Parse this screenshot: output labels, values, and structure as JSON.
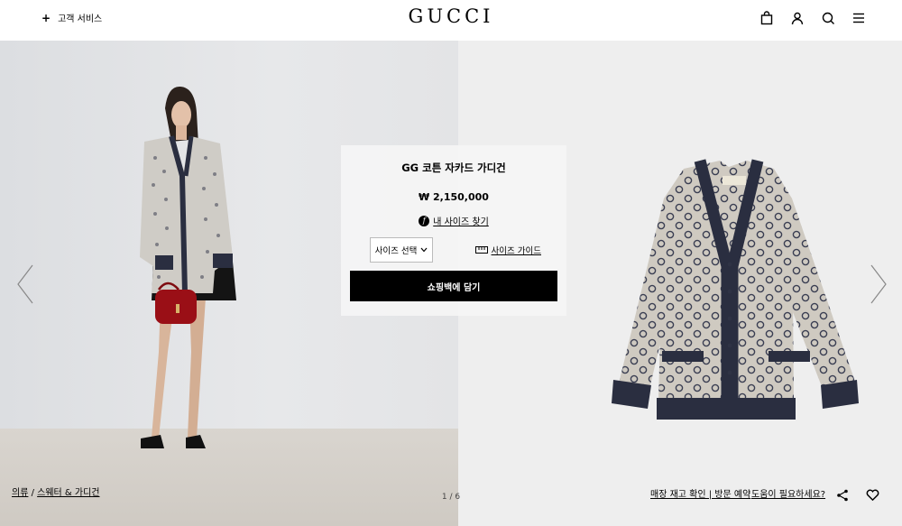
{
  "header": {
    "customer_service": "고객 서비스",
    "plus": "+",
    "logo": "GUCCI",
    "icons": [
      "shopping-bag-icon",
      "user-icon",
      "search-icon",
      "menu-icon"
    ]
  },
  "product": {
    "title": "GG 코튼 자카드 가디건",
    "price": "₩ 2,150,000",
    "fit_badge": "f",
    "find_size": "내 사이즈 찾기",
    "size_select": "사이즈 선택",
    "size_guide": "사이즈 가이드",
    "add_to_bag": "쇼핑백에 담기"
  },
  "breadcrumb": {
    "category": "의류",
    "separator": " / ",
    "subcategory": "스웨터 & 가디건"
  },
  "gallery": {
    "pager": "1 / 6",
    "current": 1,
    "total": 6
  },
  "footer": {
    "store_link": "매장 재고 확인 | 방문 예약",
    "help_link": "도움이 필요하세요?"
  },
  "colors": {
    "accent": "#000000",
    "left_bg": "#e6e7e9",
    "right_bg": "#eeeeee",
    "cardigan_base": "#c9c4bb",
    "cardigan_trim": "#262a3a"
  }
}
